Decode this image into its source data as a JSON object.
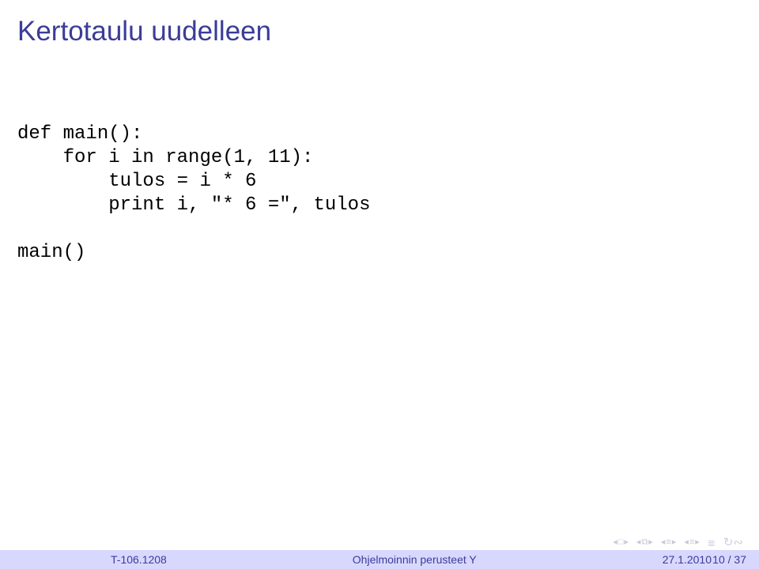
{
  "title": "Kertotaulu uudelleen",
  "code": "def main():\n    for i in range(1, 11):\n        tulos = i * 6\n        print i, \"* 6 =\", tulos\n\nmain()",
  "footer": {
    "course_code": "T-106.1208",
    "course_name": "Ohjelmoinnin perusteet Y",
    "date": "27.1.2010",
    "page": "10 / 37"
  },
  "nav": {
    "first": "first-slide-icon",
    "prev": "prev-slide-icon",
    "back": "back-icon",
    "forward": "forward-icon",
    "end": "end-icon",
    "loop": "loop-icon"
  }
}
